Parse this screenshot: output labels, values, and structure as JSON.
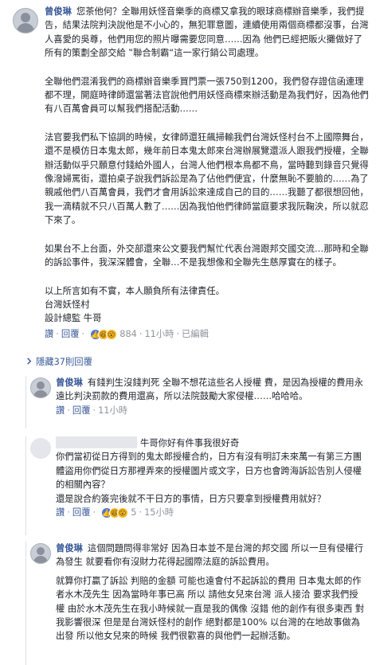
{
  "post": {
    "author": "曾俊琳",
    "paragraphs": [
      "您茶他何？全聯用妖怪音樂季的商標又拿我的眼球商標辦音樂季，我們提告，結果法院判決說他是不小心的，無犯罪意圖，連續使用兩個商標都沒事，台灣人喜愛的吳尊，他們用您的照片曝需要您同意……因為 他們已經把販火攤做好了 所有的策劃全部交給 ‟聯合制霸“這一家行銷公司處理。",
      "全聯他們混淆我們的商標辦音樂季買門票一張750到1200，我們發存證信函連理都不理，開庭時律師還當著法官說他們用妖怪商標來辦活動是為我們好，因為他們有八百萬會員可以幫我們搭配活動……",
      "法官要我們私下協調的時候，女律師還狂飆掃輸我們台灣妖怪村台不上國際舞台，還不是模仿日本鬼太郎，幾年前日本鬼太郎來台灣辦展覽還派人跟我們授權，全聯辦活動似乎只願意付錢給外國人，台灣人他們根本鳥都不鳥，當時聽到錄音只覺得像潑婦罵街，還拍桌子說我們訴訟是為了佔他們便宜，什麼無恥不要臉的……為了親戚他們八百萬會員，我們才會用訴訟來達成自己的目的……我聽了都很想回他，我一滴精就不只八百萬人數了……因為我怕他們律師當庭要求我阮鞠泱，所以就忍下來了。",
      "如果台不上台面，外交部還來公文要我們幫忙代表台灣跟邦交國交流…那時和全聯的訴訟事件，我深深體會，全聯…不是我想像和全聯先生慈厚實在的樣子。"
    ],
    "closing": "以上所言如有不實，本人願負所有法律責任。",
    "sign_company": "台灣妖怪村",
    "sign_title": "設計總監 牛哥",
    "actions": {
      "like": "讚",
      "reply": "回覆",
      "reaction_count": "884",
      "time": "11小時",
      "edited": "已編輯"
    }
  },
  "hidden_replies": "隱藏37則回覆",
  "replies": [
    {
      "author": "曾俊琳",
      "text": "有錢判生沒錢判死 全聯不想花這些名人授權 費，是因為授權的費用永遠比判決罰款的費用還高，所以法院鼓勵大家侵權……哈哈哈。",
      "actions": {
        "like": "讚",
        "reply": "回覆",
        "reaction_count": "",
        "time": "11小時"
      }
    },
    {
      "author": "",
      "text_lead": "牛哥你好有件事我很好奇",
      "text": "你們當初從日方得到的鬼太郎授權合約，日方有沒有明訂未來萬一有第三方團體盜用你們從日方那裡弄來的授權圖片或文字，日方也會跨海訴訟告別人侵權的相關內容？\n還是說合約簽完後就不干日方的事情，日方只要拿到授權費用就好？",
      "actions": {
        "like": "讚",
        "reply": "回覆",
        "reaction_count": "5",
        "time": "15小時"
      }
    },
    {
      "author": "曾俊琳",
      "text": "這個問題問得非常好 因為日本並不是台灣的邦交國 所以一旦有侵權行為發生 就要看你有沒財力花得起國際法庭的訴訟費用。",
      "text2": "就算你打贏了訴訟 判賠的金額 可能也遠會付不起訴訟的費用 日本鬼太郎的作者水木茂先生 因為當時年事已高 所以 請他女兒來台灣 派人接洽 要求我們授權 由於水木茂先生在我小時候就一直是我的偶像 沒錯 他的創作有很多東西 對我影響很深 但是是台灣妖怪村的創作 絕對都是100% 以台灣的在地故事做為出發 所以他女兒來的時候 我們很歡喜的與他們一起辦活動。"
    }
  ]
}
